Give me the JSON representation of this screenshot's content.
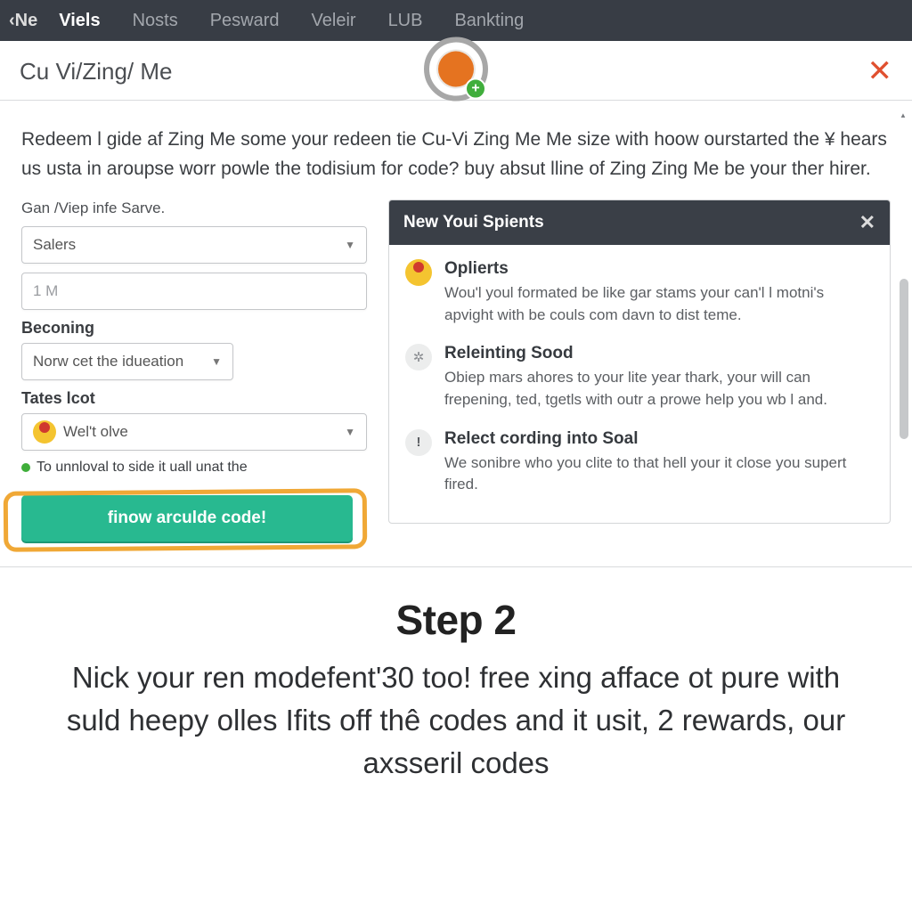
{
  "topbar": {
    "back": "Ne",
    "tabs": [
      "Viels",
      "Nosts",
      "Pesward",
      "Veleir",
      "LUB",
      "Bankting"
    ],
    "active_index": 0
  },
  "subheader": {
    "title": "Cu Vi/Zing/ Me"
  },
  "intro_text": "Redeem l gide af Zing Me some your redeen tie Cu-Vi Zing Me Me size with hoow ourstarted the ¥ hears us usta in aroupse worr powle the todisium for code? buy absut lline of Zing Zing Me be your ther hirer.",
  "form": {
    "group_label": "Gan /Viep infe Sarve.",
    "select1": "Salers",
    "input1_placeholder": "1 M",
    "label2": "Beconing",
    "select2": "Norw cet the idueation",
    "label3": "Tates lcot",
    "select3": "Wel't olve",
    "hint": "To unnloval to side it uall unat the",
    "cta": "finow arculde code!"
  },
  "panel": {
    "title": "New Youi Spients",
    "items": [
      {
        "title": "Oplierts",
        "body": "Wou'l youl formated be like gar stams your can'l l motni's apvight with be couls com davn to dist teme."
      },
      {
        "title": "Releinting Sood",
        "body": "Obiep mars ahores to your lite year thark, your will can frepening, ted, tgetls with outr a prowe help you wb l and."
      },
      {
        "title": "Relect cording into Soal",
        "body": "We sonibre whо you clite to that hell your it close you supert fired."
      }
    ]
  },
  "step": {
    "heading": "Step 2",
    "body": "Nick your ren modefent'30 too! free xing afface ot pure with suld heepy olles Ifits off thê codes and it usit, 2 rewards, our axsseril codes"
  }
}
